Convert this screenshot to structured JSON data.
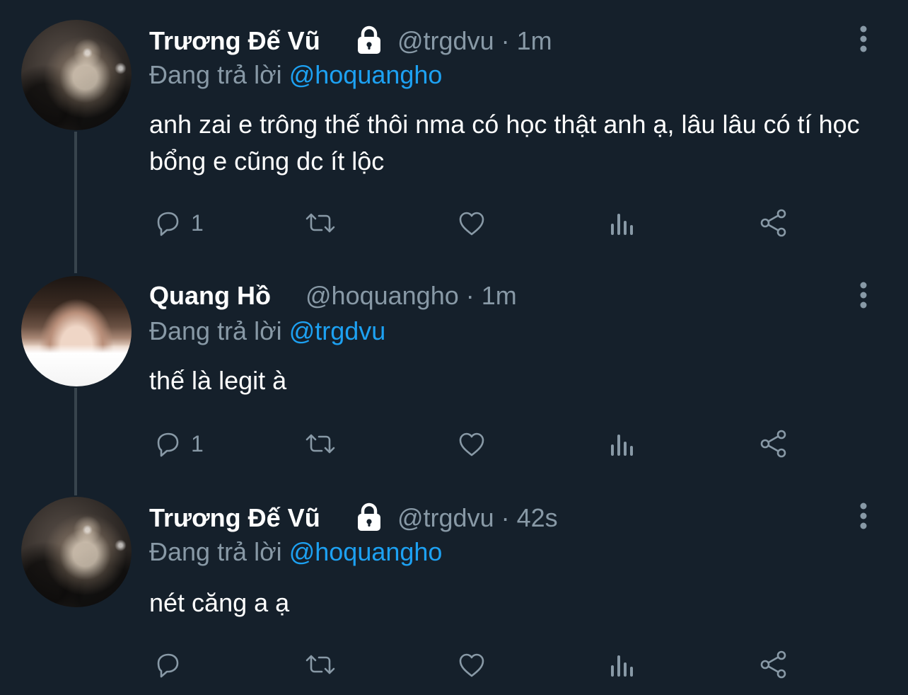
{
  "colors": {
    "background": "#15202b",
    "secondary_text": "#8899a6",
    "mention": "#1da1f2",
    "thread_line": "#38444d"
  },
  "tweets": [
    {
      "display_name": "Trương Đế Vũ",
      "locked": true,
      "handle": "@trgdvu",
      "separator": "·",
      "time": "1m",
      "replying_prefix": "Đang trả lời",
      "replying_to": "@hoquangho",
      "text": "anh zai e trông thế thôi nma có học thật anh ạ, lâu lâu có tí học bổng e cũng dc ít lộc",
      "reply_count": "1",
      "icons": [
        "reply-icon",
        "retweet-icon",
        "like-icon",
        "analytics-icon",
        "share-icon"
      ]
    },
    {
      "display_name": "Quang Hồ",
      "locked": false,
      "handle": "@hoquangho",
      "separator": "·",
      "time": "1m",
      "replying_prefix": "Đang trả lời",
      "replying_to": "@trgdvu",
      "text": "thế là legit à",
      "reply_count": "1",
      "icons": [
        "reply-icon",
        "retweet-icon",
        "like-icon",
        "analytics-icon",
        "share-icon"
      ]
    },
    {
      "display_name": "Trương Đế Vũ",
      "locked": true,
      "handle": "@trgdvu",
      "separator": "·",
      "time": "42s",
      "replying_prefix": "Đang trả lời",
      "replying_to": "@hoquangho",
      "text": "nét căng a ạ",
      "reply_count": "",
      "icons": [
        "reply-icon",
        "retweet-icon",
        "like-icon",
        "analytics-icon",
        "share-icon"
      ]
    }
  ]
}
